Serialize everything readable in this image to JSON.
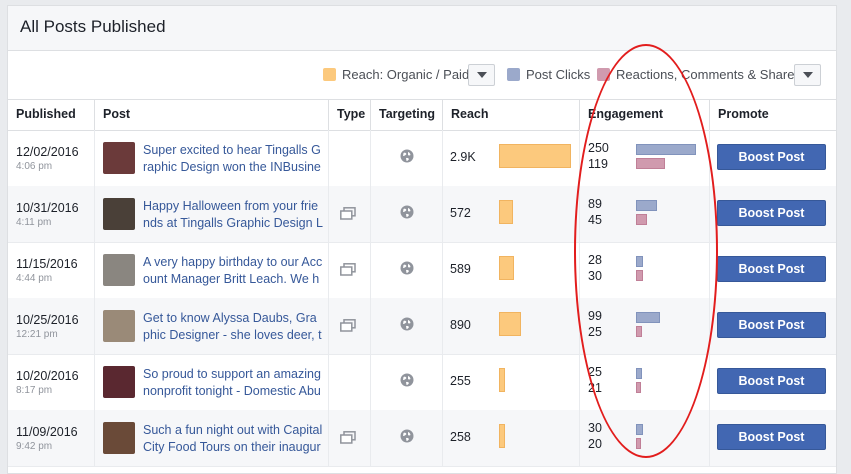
{
  "panel": {
    "title": "All Posts Published"
  },
  "legend": {
    "items": [
      {
        "label": "Reach: Organic / Paid",
        "color": "#fcc97d"
      },
      {
        "label": "Post Clicks",
        "color": "#9ba9cb"
      },
      {
        "label": "Reactions, Comments & Shares",
        "color": "#d09aae"
      }
    ],
    "dropdown_icon": "caret-down-icon"
  },
  "columns": [
    "Published",
    "Post",
    "Type",
    "Targeting",
    "Reach",
    "Engagement",
    "Promote"
  ],
  "rows": [
    {
      "date": "12/02/2016",
      "time": "4:06 pm",
      "post": "Super excited to hear Tingalls Graphic Design won the INBusines",
      "thumb": "#6b3a3a",
      "has_type_icon": false,
      "reach": "2.9K",
      "reach_value": 2900,
      "clicks": "250",
      "reactions": "119",
      "boost_label": "Boost Post"
    },
    {
      "date": "10/31/2016",
      "time": "4:11 pm",
      "post": "Happy Halloween from your friends at Tingalls Graphic Design LL",
      "thumb": "#4a4038",
      "has_type_icon": true,
      "reach": "572",
      "reach_value": 572,
      "clicks": "89",
      "reactions": "45",
      "boost_label": "Boost Post"
    },
    {
      "date": "11/15/2016",
      "time": "4:44 pm",
      "post": "A very happy birthday to our Account Manager Britt Leach. We ho",
      "thumb": "#8a8680",
      "has_type_icon": true,
      "reach": "589",
      "reach_value": 589,
      "clicks": "28",
      "reactions": "30",
      "boost_label": "Boost Post"
    },
    {
      "date": "10/25/2016",
      "time": "12:21 pm",
      "post": "Get to know Alyssa Daubs, Graphic Designer - she loves deer, th",
      "thumb": "#9a8a78",
      "has_type_icon": true,
      "reach": "890",
      "reach_value": 890,
      "clicks": "99",
      "reactions": "25",
      "boost_label": "Boost Post"
    },
    {
      "date": "10/20/2016",
      "time": "8:17 pm",
      "post": "So proud to support an amazing nonprofit tonight - Domestic Abu",
      "thumb": "#5a2830",
      "has_type_icon": false,
      "reach": "255",
      "reach_value": 255,
      "clicks": "25",
      "reactions": "21",
      "boost_label": "Boost Post"
    },
    {
      "date": "11/09/2016",
      "time": "9:42 pm",
      "post": "Such a fun night out with Capital City Food Tours on their inaugur",
      "thumb": "#6a4a38",
      "has_type_icon": true,
      "reach": "258",
      "reach_value": 258,
      "clicks": "30",
      "reactions": "20",
      "boost_label": "Boost Post"
    }
  ],
  "icons": {
    "type": "multi-photo-icon",
    "targeting": "globe-icon"
  }
}
